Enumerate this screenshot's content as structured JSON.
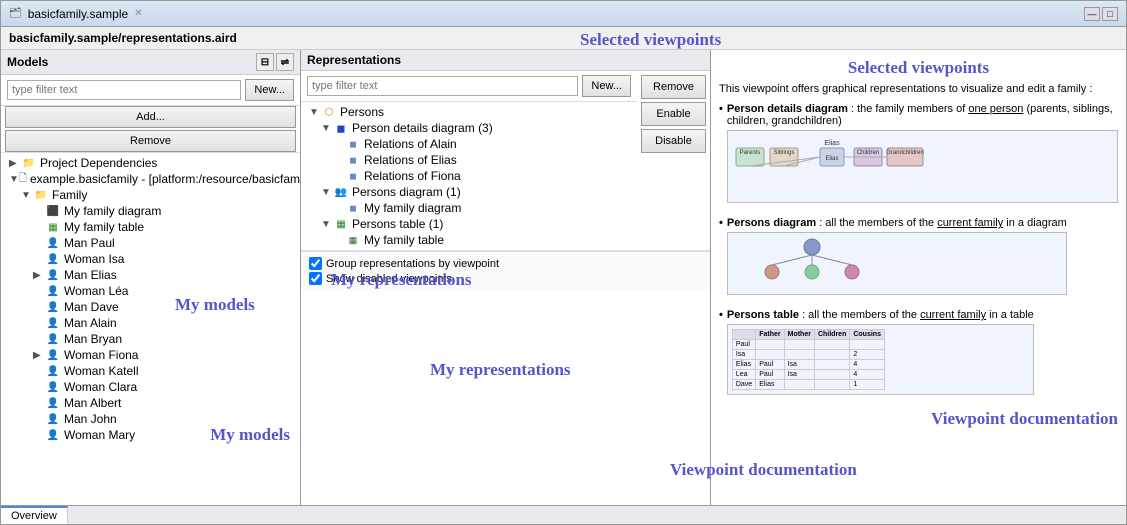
{
  "window": {
    "title": "basicfamily.sample",
    "close_tab": "✕",
    "minimize": "—",
    "maximize": "□"
  },
  "file_path": "basicfamily.sample/representations.aird",
  "left_panel": {
    "header": "Models",
    "filter_placeholder": "type filter text",
    "new_btn": "New...",
    "add_btn": "Add...",
    "remove_btn": "Remove",
    "tree": [
      {
        "level": 0,
        "label": "Project Dependencies",
        "icon": "folder",
        "expanded": true,
        "id": "proj-dep"
      },
      {
        "level": 0,
        "label": "example.basicfamily - [platform:/resource/basicfam",
        "icon": "file",
        "expanded": true,
        "id": "example"
      },
      {
        "level": 1,
        "label": "Family",
        "icon": "folder-blue",
        "expanded": true,
        "id": "family"
      },
      {
        "level": 2,
        "label": "My family diagram",
        "icon": "diagram",
        "id": "my-fam-diag"
      },
      {
        "level": 2,
        "label": "My family table",
        "icon": "table",
        "id": "my-fam-table"
      },
      {
        "level": 2,
        "label": "Man Paul",
        "icon": "person-m",
        "id": "man-paul"
      },
      {
        "level": 2,
        "label": "Woman Isa",
        "icon": "person-f",
        "id": "woman-isa"
      },
      {
        "level": 2,
        "label": "Man Elias",
        "icon": "person-m",
        "expanded": false,
        "id": "man-elias"
      },
      {
        "level": 2,
        "label": "Woman Léa",
        "icon": "person-f",
        "id": "woman-lea"
      },
      {
        "level": 2,
        "label": "Man Dave",
        "icon": "person-m",
        "id": "man-dave"
      },
      {
        "level": 2,
        "label": "Man Alain",
        "icon": "person-m",
        "id": "man-alain"
      },
      {
        "level": 2,
        "label": "Man Bryan",
        "icon": "person-m",
        "id": "man-bryan"
      },
      {
        "level": 2,
        "label": "Woman Fiona",
        "icon": "person-f",
        "expanded": false,
        "id": "woman-fiona"
      },
      {
        "level": 2,
        "label": "Woman Katell",
        "icon": "person-f",
        "id": "woman-katell"
      },
      {
        "level": 2,
        "label": "Woman Clara",
        "icon": "person-f",
        "id": "woman-clara"
      },
      {
        "level": 2,
        "label": "Man Albert",
        "icon": "person-m",
        "id": "man-albert"
      },
      {
        "level": 2,
        "label": "Man John",
        "icon": "person-m",
        "id": "man-john"
      },
      {
        "level": 2,
        "label": "Woman Mary",
        "icon": "person-f",
        "id": "woman-mary"
      }
    ]
  },
  "middle_panel": {
    "header": "Representations",
    "filter_placeholder": "type filter text",
    "new_btn": "New...",
    "remove_btn": "Remove",
    "enable_btn": "Enable",
    "disable_btn": "Disable",
    "tree": [
      {
        "level": 0,
        "label": "Persons",
        "icon": "group",
        "expanded": true,
        "id": "persons-group"
      },
      {
        "level": 1,
        "label": "Person details diagram (3)",
        "icon": "diagram",
        "expanded": true,
        "id": "person-details"
      },
      {
        "level": 2,
        "label": "Relations of Alain",
        "icon": "diagram-sm",
        "id": "rel-alain"
      },
      {
        "level": 2,
        "label": "Relations of Elias",
        "icon": "diagram-sm",
        "id": "rel-elias"
      },
      {
        "level": 2,
        "label": "Relations of Fiona",
        "icon": "diagram-sm",
        "id": "rel-fiona"
      },
      {
        "level": 1,
        "label": "Persons diagram (1)",
        "icon": "diagram",
        "expanded": true,
        "id": "persons-diagram"
      },
      {
        "level": 2,
        "label": "My family diagram",
        "icon": "diagram-sm",
        "id": "my-fam-diag2"
      },
      {
        "level": 1,
        "label": "Persons table (1)",
        "icon": "table",
        "expanded": true,
        "id": "persons-table"
      },
      {
        "level": 2,
        "label": "My family table",
        "icon": "table-sm",
        "id": "my-fam-table2"
      }
    ],
    "checkbox1_label": "Group representations by viewpoint",
    "checkbox2_label": "Show disabled viewpoints"
  },
  "right_panel": {
    "intro": "This viewpoint offers graphical representations to visualize and edit a family :",
    "bullets": [
      {
        "label": "Person details diagram",
        "text": " : the family members of ",
        "underline": "one person",
        "text2": " (parents, siblings, children, grandchildren)"
      },
      {
        "label": "Persons diagram",
        "text": ": all the members of the ",
        "underline": "current family",
        "text2": " in a diagram"
      },
      {
        "label": "Persons table",
        "text": ": all the members of the ",
        "underline": "current family",
        "text2": " in a table"
      }
    ]
  },
  "annotations": {
    "selected_viewpoints": "Selected viewpoints",
    "my_models": "My models",
    "my_representations": "My representations",
    "viewpoint_documentation": "Viewpoint documentation"
  },
  "bottom_tab": "Overview"
}
